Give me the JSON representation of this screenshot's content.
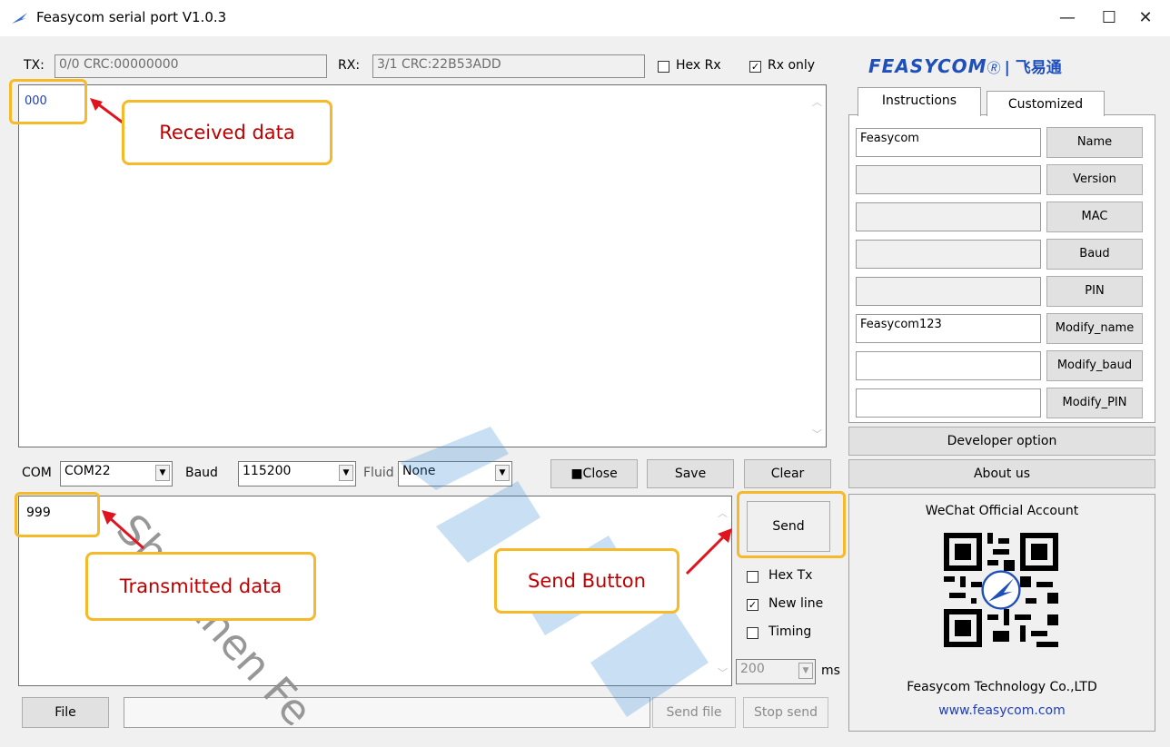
{
  "window": {
    "title": "Feasycom serial port V1.0.3",
    "minimize_glyph": "—",
    "maximize_glyph": "☐",
    "close_glyph": "✕"
  },
  "status": {
    "tx_label": "TX:",
    "tx_value": "0/0 CRC:00000000",
    "rx_label": "RX:",
    "rx_value": "3/1 CRC:22B53ADD",
    "hex_rx_label": "Hex Rx",
    "hex_rx_checked": false,
    "rx_only_label": "Rx only",
    "rx_only_checked": true
  },
  "receive": {
    "text": "000"
  },
  "settings": {
    "com_label": "COM",
    "com_value": "COM22",
    "baud_label": "Baud",
    "baud_value": "115200",
    "fluid_label": "Fluid",
    "fluid_value": "None",
    "close_label": "■Close",
    "save_label": "Save",
    "clear_label": "Clear"
  },
  "transmit": {
    "text": "999"
  },
  "send_panel": {
    "send_label": "Send",
    "hex_tx_label": "Hex Tx",
    "hex_tx_checked": false,
    "new_line_label": "New line",
    "new_line_checked": true,
    "timing_label": "Timing",
    "timing_checked": false,
    "interval_value": "200",
    "interval_unit": "ms"
  },
  "file_bar": {
    "file_label": "File",
    "path_value": "",
    "send_file_label": "Send file",
    "stop_send_label": "Stop send"
  },
  "brand": {
    "logo_text": "FEASYCOM",
    "logo_cn": "| 飞易通",
    "color": "#1f4fb8"
  },
  "tabs": [
    {
      "label": "Instructions",
      "active": true
    },
    {
      "label": "Customized",
      "active": false
    }
  ],
  "commands": [
    {
      "value": "Feasycom",
      "button": "Name"
    },
    {
      "value": "",
      "button": "Version"
    },
    {
      "value": "",
      "button": "MAC"
    },
    {
      "value": "",
      "button": "Baud"
    },
    {
      "value": "",
      "button": "PIN"
    },
    {
      "value": "Feasycom123",
      "button": "Modify_name"
    },
    {
      "value": "",
      "button": "Modify_baud"
    },
    {
      "value": "",
      "button": "Modify_PIN"
    }
  ],
  "developer_option_label": "Developer option",
  "about_us_label": "About us",
  "wechat": {
    "title": "WeChat Official Account",
    "company": "Feasycom Technology Co.,LTD",
    "website": "www.feasycom.com"
  },
  "annotations": {
    "received": "Received data",
    "transmitted": "Transmitted data",
    "send_button": "Send Button"
  },
  "watermark": {
    "text": "Shenzhen Fe"
  }
}
